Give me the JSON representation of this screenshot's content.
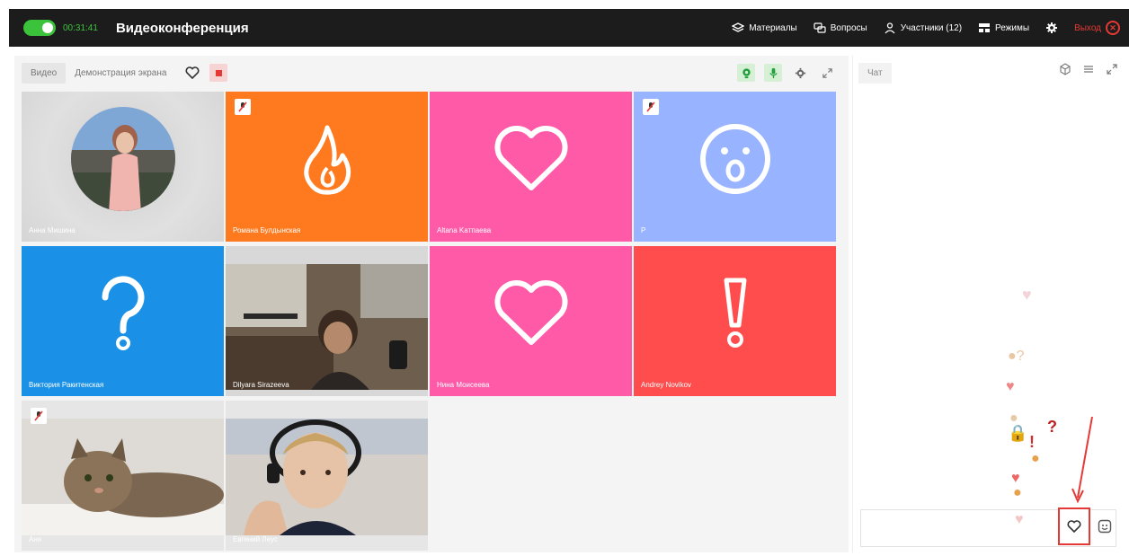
{
  "topbar": {
    "timer": "00:31:41",
    "title": "Видеоконференция",
    "materials": "Материалы",
    "questions": "Вопросы",
    "participants": "Участники (12)",
    "modes": "Режимы",
    "exit": "Выход"
  },
  "toolbar": {
    "video_tab": "Видео",
    "screen_tab": "Демонстрация экрана"
  },
  "tiles": [
    {
      "name": "Анна Мишина",
      "kind": "photo-woman",
      "color": "#d9d9d9"
    },
    {
      "name": "Романа Булдынская",
      "kind": "fire",
      "color": "#ff7a1f",
      "muted": true
    },
    {
      "name": "Altana Kaтпаева",
      "kind": "heart",
      "color": "#ff5aa8"
    },
    {
      "name": "P",
      "kind": "wow",
      "color": "#98b3ff",
      "muted": true
    },
    {
      "name": "Виктория Ракитенская",
      "kind": "question",
      "color": "#1a91e6"
    },
    {
      "name": "Dilyara Sirazeeva",
      "kind": "photo-room",
      "color": "#6b5b4a"
    },
    {
      "name": "Нина Моисеева",
      "kind": "heart",
      "color": "#ff5aa8"
    },
    {
      "name": "Andrey Novikov",
      "kind": "exclaim",
      "color": "#ff4d4d"
    },
    {
      "name": "Аня",
      "kind": "photo-cat",
      "color": "#cfc7bd",
      "muted": true
    },
    {
      "name": "Евгений Леус",
      "kind": "photo-boy",
      "color": "#cdb9a4"
    }
  ],
  "chat": {
    "tab": "Чат"
  }
}
